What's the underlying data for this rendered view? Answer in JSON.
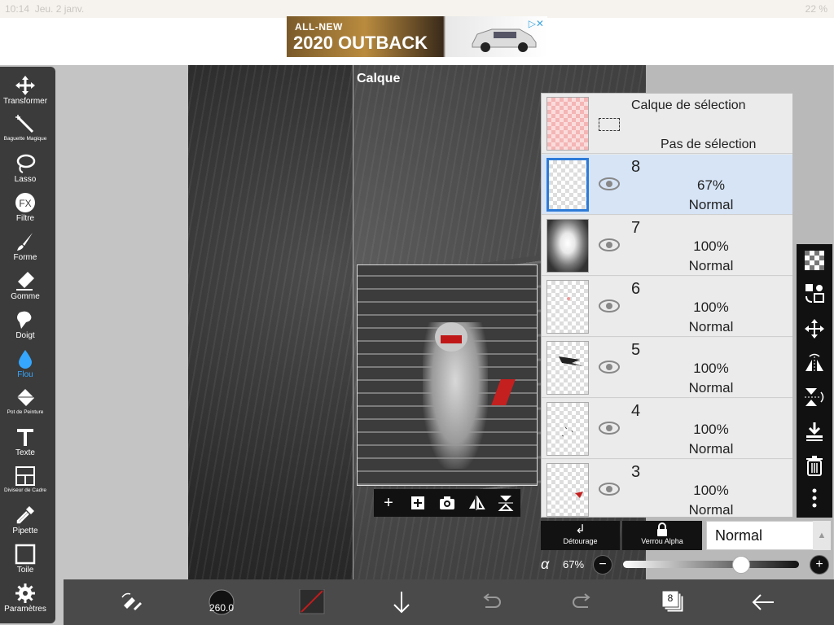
{
  "status_bar": {
    "time": "10:14",
    "date": "Jeu. 2 janv.",
    "battery": "22 %"
  },
  "ad": {
    "line1": "ALL-NEW",
    "line2": "2020 OUTBACK",
    "close_icon": "close-icon"
  },
  "tools": [
    {
      "label": "Transformer",
      "icon": "move-icon"
    },
    {
      "label": "Baguette Magique",
      "icon": "magic-wand-icon"
    },
    {
      "label": "Lasso",
      "icon": "lasso-icon"
    },
    {
      "label": "Filtre",
      "icon": "fx-icon"
    },
    {
      "label": "Forme",
      "icon": "brush-icon"
    },
    {
      "label": "Gomme",
      "icon": "eraser-icon"
    },
    {
      "label": "Doigt",
      "icon": "smudge-icon"
    },
    {
      "label": "Flou",
      "icon": "blur-drop-icon"
    },
    {
      "label": "Pot de Peinture",
      "icon": "bucket-icon"
    },
    {
      "label": "Texte",
      "icon": "text-icon"
    },
    {
      "label": "Diviseur de Cadre",
      "icon": "frame-divider-icon"
    },
    {
      "label": "Pipette",
      "icon": "eyedropper-icon"
    },
    {
      "label": "Toile",
      "icon": "canvas-icon"
    },
    {
      "label": "Paramètres",
      "icon": "gear-icon"
    }
  ],
  "layer_panel": {
    "title": "Calque",
    "selection_layer": {
      "title": "Calque de sélection",
      "subtitle": "Pas de sélection"
    },
    "layers": [
      {
        "number": "8",
        "opacity": "67%",
        "mode": "Normal"
      },
      {
        "number": "7",
        "opacity": "100%",
        "mode": "Normal"
      },
      {
        "number": "6",
        "opacity": "100%",
        "mode": "Normal"
      },
      {
        "number": "5",
        "opacity": "100%",
        "mode": "Normal"
      },
      {
        "number": "4",
        "opacity": "100%",
        "mode": "Normal"
      },
      {
        "number": "3",
        "opacity": "100%",
        "mode": "Normal"
      }
    ],
    "clipping_label": "Détourage",
    "alpha_lock_label": "Verrou Alpha",
    "blend_mode": "Normal",
    "alpha_symbol": "α",
    "alpha_value": "67%",
    "alpha_fraction": 0.67
  },
  "preview_toolbar": [
    "plus-icon",
    "add-layer-icon",
    "camera-icon",
    "flip-horizontal-icon",
    "flip-vertical-icon"
  ],
  "right_toolbar": [
    "checker-icon",
    "transform-layer-icon",
    "move-icon",
    "flip-horizontal-icon",
    "flip-vertical-icon",
    "merge-down-icon",
    "trash-icon",
    "more-icon"
  ],
  "bottom_bar": {
    "brush_size": "260.0",
    "layer_count": "8"
  },
  "colors": {
    "accent": "#35a7ff",
    "selected_row": "#d6e4f6",
    "toolbar": "#3b3b3b"
  }
}
